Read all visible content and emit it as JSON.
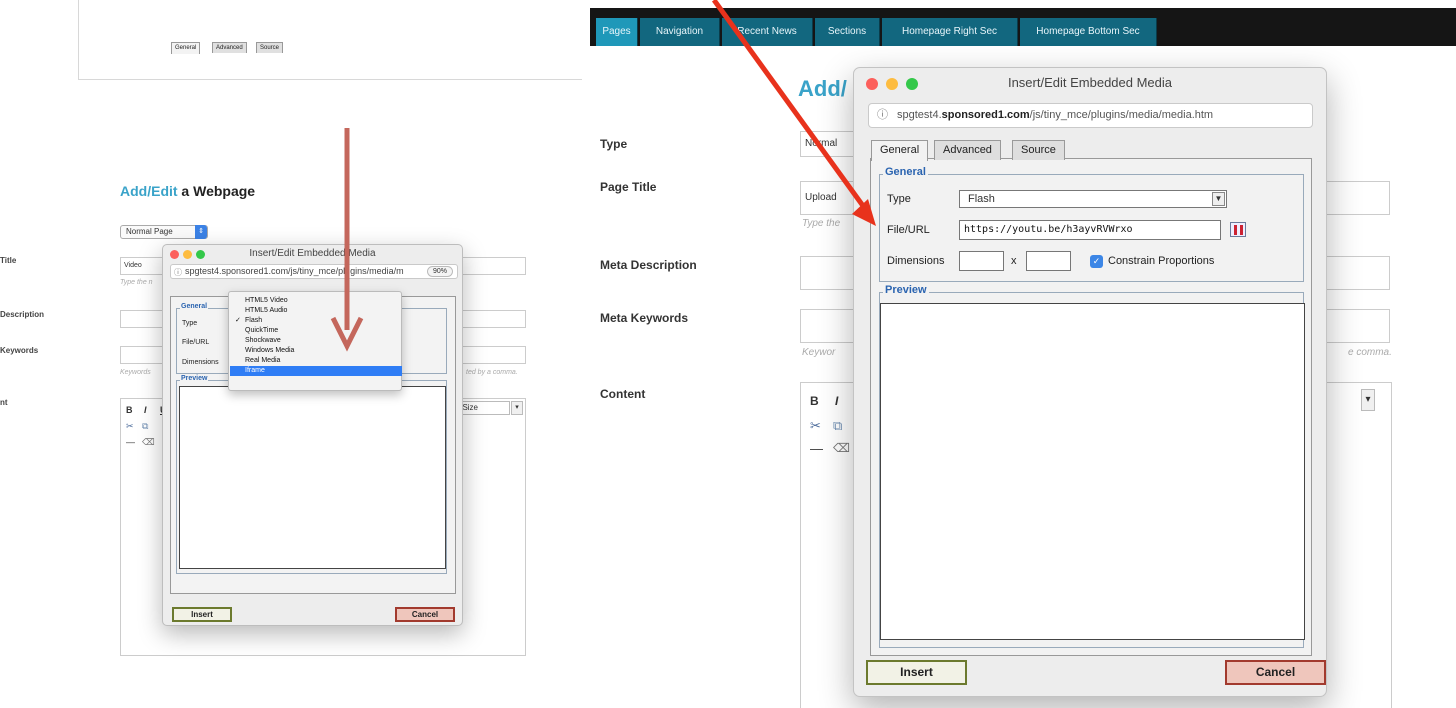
{
  "left": {
    "heading_accent": "Add/Edit",
    "heading_rest": " a Webpage",
    "page_type_select": "Normal Page",
    "labels": {
      "title": "Title",
      "description": "Description",
      "keywords": "Keywords",
      "content": "nt"
    },
    "title_value": "Video",
    "title_hint": "Type the n",
    "keywords_hint": "Keywords",
    "keywords_hint_right": "ted by a comma.",
    "toolbar_bold": "B",
    "toolbar_italic": "I",
    "toolbar_underline": "U",
    "font_size_label": "t Size",
    "modal": {
      "title": "Insert/Edit Embedded Media",
      "url": "spgtest4.sponsored1.com/js/tiny_mce/plugins/media/m",
      "zoom": "90%",
      "tabs": [
        "General",
        "Advanced",
        "Source"
      ],
      "legend_general": "General",
      "legend_preview": "Preview",
      "label_type": "Type",
      "label_file": "File/URL",
      "label_dimensions": "Dimensions",
      "insert": "Insert",
      "cancel": "Cancel"
    },
    "media_type_menu": {
      "items": [
        "HTML5 Video",
        "HTML5 Audio",
        "Flash",
        "QuickTime",
        "Shockwave",
        "Windows Media",
        "Real Media",
        "Iframe"
      ],
      "checked": "Flash",
      "highlighted": "Iframe"
    }
  },
  "right": {
    "nav_tabs": [
      "Pages",
      "Navigation",
      "Recent News",
      "Sections",
      "Homepage Right Sec",
      "Homepage Bottom Sec"
    ],
    "heading_partial": "Add/",
    "labels": {
      "type": "Type",
      "page_title": "Page Title",
      "meta_description": "Meta Description",
      "meta_keywords": "Meta Keywords",
      "content": "Content"
    },
    "type_value": "Normal",
    "page_title_value": "Upload",
    "page_title_hint": "Type the",
    "keywords_hint": "Keywor",
    "keywords_hint_right": "e comma.",
    "toolbar_bold": "B",
    "toolbar_italic": "I",
    "modal": {
      "title": "Insert/Edit Embedded Media",
      "url_host_prefix": "spgtest4.",
      "url_host_domain": "sponsored1.com",
      "url_path": "/js/tiny_mce/plugins/media/media.htm",
      "tabs": [
        "General",
        "Advanced",
        "Source"
      ],
      "legend_general": "General",
      "legend_preview": "Preview",
      "label_type": "Type",
      "type_value": "Flash",
      "label_file": "File/URL",
      "file_url_value": "https://youtu.be/h3ayvRVWrxo",
      "label_dimensions": "Dimensions",
      "dimension_separator": "x",
      "constrain_label": "Constrain Proportions",
      "constrain_checked": true,
      "insert": "Insert",
      "cancel": "Cancel"
    }
  },
  "colors": {
    "accent_teal": "#3aa3c9",
    "nav_active": "#1f98b9",
    "nav_tab": "#12677f",
    "legend_blue": "#2b64b0",
    "menu_highlight": "#2f7df5",
    "arrow_red": "#e8321c",
    "arrow_muted": "#c4675c"
  }
}
